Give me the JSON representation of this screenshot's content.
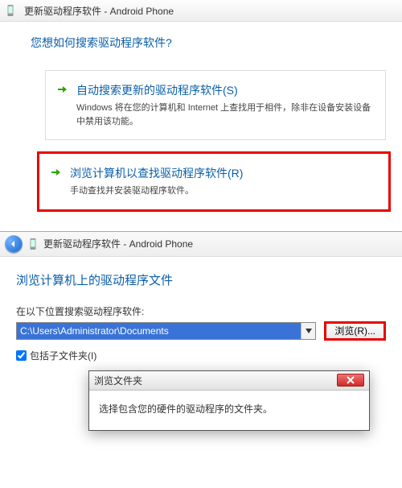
{
  "top_window": {
    "title": "更新驱动程序软件 - Android Phone",
    "question": "您想如何搜索驱动程序软件?",
    "option_auto": {
      "title": "自动搜索更新的驱动程序软件(S)",
      "desc": "Windows 将在您的计算机和 Internet 上查找用于相件，除非在设备安装设备中禁用该功能。"
    },
    "option_browse": {
      "title": "浏览计算机以查找驱动程序软件(R)",
      "desc": "手动查找并安装驱动程序软件。"
    }
  },
  "lower_window": {
    "title": "更新驱动程序软件 - Android Phone",
    "heading": "浏览计算机上的驱动程序文件",
    "field_label": "在以下位置搜索驱动程序软件:",
    "path_value": "C:\\Users\\Administrator\\Documents",
    "browse_btn": "浏览(R)...",
    "checkbox_label": "包括子文件夹(I)",
    "checkbox_checked": true
  },
  "dialog": {
    "title": "浏览文件夹",
    "instruction": "选择包含您的硬件的驱动程序的文件夹。"
  }
}
